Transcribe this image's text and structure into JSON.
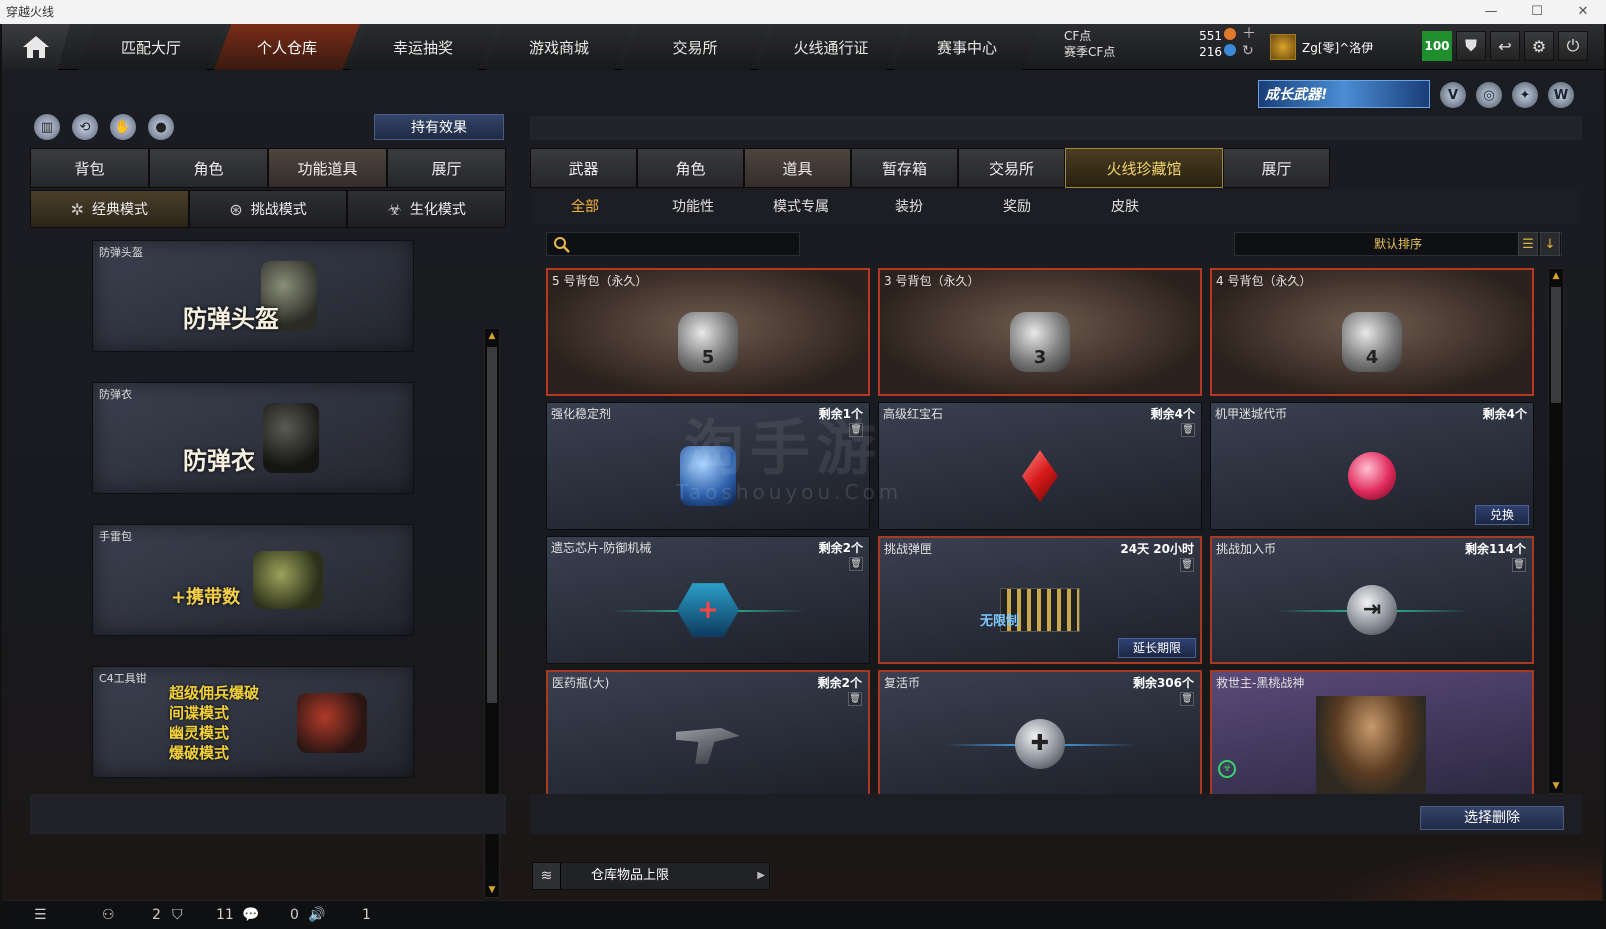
{
  "window": {
    "title": "穿越火线",
    "min": "—",
    "max": "☐",
    "close": "✕"
  },
  "topnav": {
    "tabs": [
      "匹配大厅",
      "个人仓库",
      "幸运抽奖",
      "游戏商城",
      "交易所",
      "火线通行证",
      "赛事中心"
    ],
    "active_tab": "个人仓库",
    "cf_label": "CF点",
    "season_cf_label": "赛季CF点",
    "cf_value": "551",
    "season_cf_value": "216",
    "username": "Zg[零]^洛伊",
    "level": "100"
  },
  "banner": {
    "text": "成长武器!"
  },
  "left": {
    "effect_button": "持有效果",
    "tabs": [
      "背包",
      "角色",
      "功能道具",
      "展厅"
    ],
    "active_tab": "功能道具",
    "modes": [
      "经典模式",
      "挑战模式",
      "生化模式"
    ],
    "active_mode": "经典模式",
    "cards": [
      {
        "label": "防弹头盔",
        "big": "防弹头盔"
      },
      {
        "label": "防弹衣",
        "big": "防弹衣"
      },
      {
        "label": "手雷包",
        "big": "+携带数"
      },
      {
        "label": "C4工具钳",
        "lines": [
          "超级佣兵爆破",
          "间谍模式",
          "幽灵模式",
          "爆破模式"
        ]
      }
    ]
  },
  "right": {
    "tabs": [
      "武器",
      "角色",
      "道具",
      "暂存箱",
      "交易所",
      "火线珍藏馆",
      "展厅"
    ],
    "active_tab": "道具",
    "subtabs": [
      "全部",
      "功能性",
      "模式专属",
      "装扮",
      "奖励",
      "皮肤"
    ],
    "active_subtab": "全部",
    "search_placeholder": "",
    "sort_label": "默认排序",
    "items": [
      {
        "name": "5 号背包（永久）",
        "qty": "",
        "bag": "5"
      },
      {
        "name": "3 号背包（永久）",
        "qty": "",
        "bag": "3"
      },
      {
        "name": "4 号背包（永久）",
        "qty": "",
        "bag": "4"
      },
      {
        "name": "强化稳定剂",
        "qty": "剩余1个"
      },
      {
        "name": "高级红宝石",
        "qty": "剩余4个"
      },
      {
        "name": "机甲迷城代币",
        "qty": "剩余4个",
        "action": "兑换"
      },
      {
        "name": "遗忘芯片-防御机械",
        "qty": "剩余2个"
      },
      {
        "name": "挑战弹匣",
        "qty": "24天 20小时",
        "action": "延长期限",
        "badge": "无限制"
      },
      {
        "name": "挑战加入币",
        "qty": "剩余114个"
      },
      {
        "name": "医药瓶(大)",
        "qty": "剩余2个"
      },
      {
        "name": "复活币",
        "qty": "剩余306个"
      },
      {
        "name": "救世主-黑桃战神",
        "qty": ""
      }
    ],
    "delete_button": "选择删除",
    "capacity_label": "仓库物品上限"
  },
  "watermark": {
    "main": "淘手游",
    "sub": "Taoshouyou.Com"
  },
  "status": {
    "v1": "2",
    "v2": "11",
    "v3": "0",
    "v4": "1"
  }
}
